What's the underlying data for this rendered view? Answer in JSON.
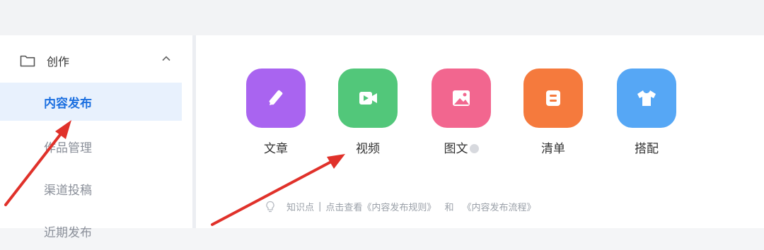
{
  "sidebar": {
    "section_title": "创作",
    "items": [
      {
        "label": "内容发布",
        "active": true
      },
      {
        "label": "作品管理",
        "active": false
      },
      {
        "label": "渠道投稿",
        "active": false
      },
      {
        "label": "近期发布",
        "active": false
      }
    ]
  },
  "content_types": [
    {
      "label": "文章",
      "icon": "pen-icon",
      "color": "#a964f0"
    },
    {
      "label": "视频",
      "icon": "video-icon",
      "color": "#52c77a"
    },
    {
      "label": "图文",
      "icon": "image-icon",
      "color": "#f2668f"
    },
    {
      "label": "清单",
      "icon": "list-icon",
      "color": "#f57a3d"
    },
    {
      "label": "搭配",
      "icon": "shirt-icon",
      "color": "#56a7f5"
    }
  ],
  "knowledge": {
    "prefix": "知识点",
    "separator": "|",
    "text": "点击查看",
    "link1": "《内容发布规则》",
    "conjunction": "和",
    "link2": "《内容发布流程》"
  },
  "annotation_color": "#e0312a"
}
